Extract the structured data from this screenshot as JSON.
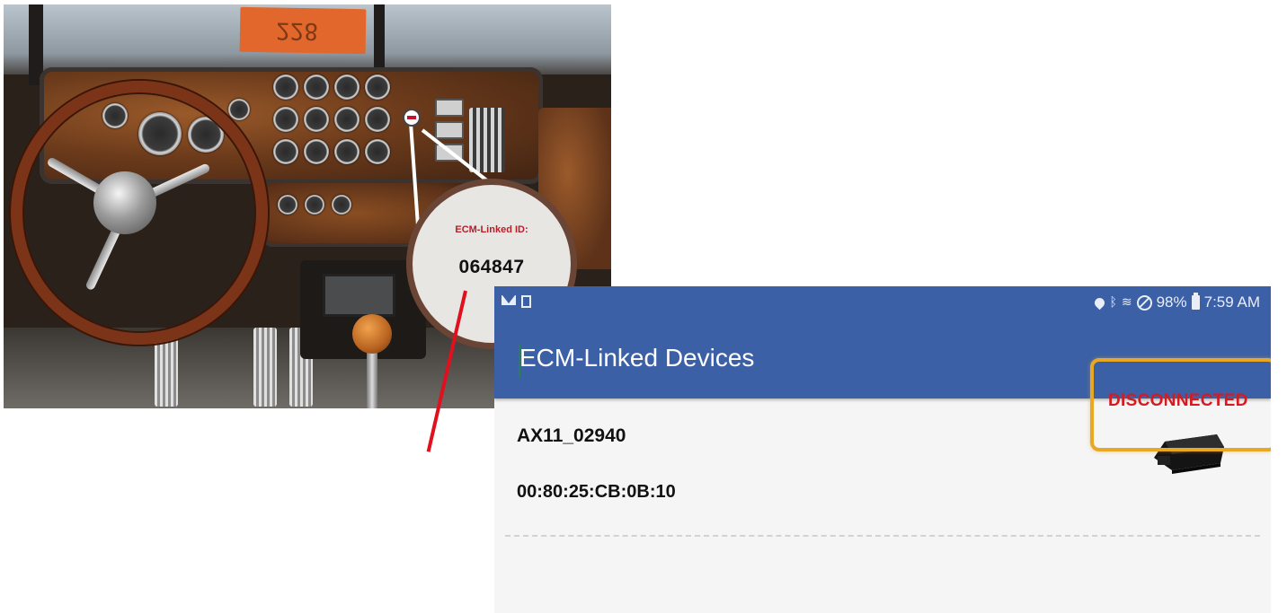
{
  "photo": {
    "callout_label": "ECM-Linked ID:",
    "callout_value": "064847",
    "sign_text": "228"
  },
  "app": {
    "status_bar": {
      "battery": "98%",
      "time": "7:59 AM",
      "left_icons": [
        "mail-icon",
        "document-icon"
      ],
      "right_icons": [
        "location-icon",
        "bluetooth-icon",
        "wifi-icon",
        "do-not-disturb-icon",
        "battery-icon"
      ]
    },
    "title": "ECM-Linked Devices",
    "devices": [
      {
        "name": "AX11_02940",
        "mac": "00:80:25:CB:0B:10",
        "status": "DISCONNECTED",
        "icon": "eld-device-icon"
      }
    ]
  },
  "colors": {
    "appbar": "#3c60a6",
    "status_disconnected": "#d71920",
    "highlight": "#e8a825",
    "arrow": "#e1101e",
    "callout_label": "#b3202a"
  }
}
